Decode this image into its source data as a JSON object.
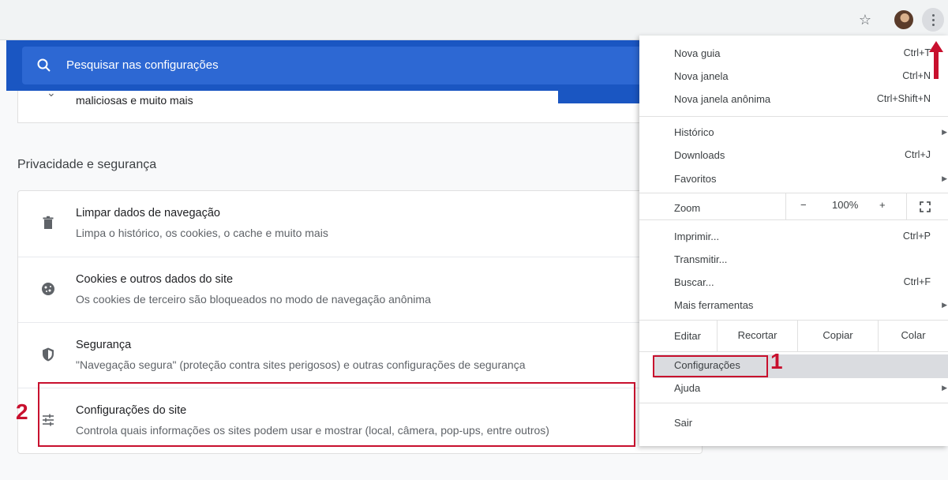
{
  "toolbar": {
    "icons": [
      "star-icon",
      "avatar",
      "kebab-menu-icon"
    ]
  },
  "search": {
    "placeholder": "Pesquisar nas configurações"
  },
  "previous_card": {
    "text": "maliciosas e muito mais"
  },
  "section": {
    "title": "Privacidade e segurança"
  },
  "rows": [
    {
      "title": "Limpar dados de navegação",
      "desc": "Limpa o histórico, os cookies, o cache e muito mais",
      "icon": "trash-icon"
    },
    {
      "title": "Cookies e outros dados do site",
      "desc": "Os cookies de terceiro são bloqueados no modo de navegação anônima",
      "icon": "cookie-icon"
    },
    {
      "title": "Segurança",
      "desc": "\"Navegação segura\" (proteção contra sites perigosos) e outras configurações de segurança",
      "icon": "shield-icon"
    },
    {
      "title": "Configurações do site",
      "desc": "Controla quais informações os sites podem usar e mostrar (local, câmera, pop-ups, entre outros)",
      "icon": "sliders-icon"
    }
  ],
  "menu": {
    "new_tab": "Nova guia",
    "new_tab_shortcut": "Ctrl+T",
    "new_window": "Nova janela",
    "new_window_shortcut": "Ctrl+N",
    "incognito": "Nova janela anônima",
    "incognito_shortcut": "Ctrl+Shift+N",
    "history": "Histórico",
    "downloads": "Downloads",
    "downloads_shortcut": "Ctrl+J",
    "bookmarks": "Favoritos",
    "zoom": "Zoom",
    "zoom_minus": "−",
    "zoom_value": "100%",
    "zoom_plus": "+",
    "print": "Imprimir...",
    "print_shortcut": "Ctrl+P",
    "cast": "Transmitir...",
    "find": "Buscar...",
    "find_shortcut": "Ctrl+F",
    "more_tools": "Mais ferramentas",
    "edit": "Editar",
    "cut": "Recortar",
    "copy": "Copiar",
    "paste": "Colar",
    "settings": "Configurações",
    "help": "Ajuda",
    "exit": "Sair"
  },
  "annotations": {
    "step1": "1",
    "step2": "2"
  },
  "colors": {
    "header_blue": "#1a56c2",
    "annotation_red": "#c8102e"
  }
}
